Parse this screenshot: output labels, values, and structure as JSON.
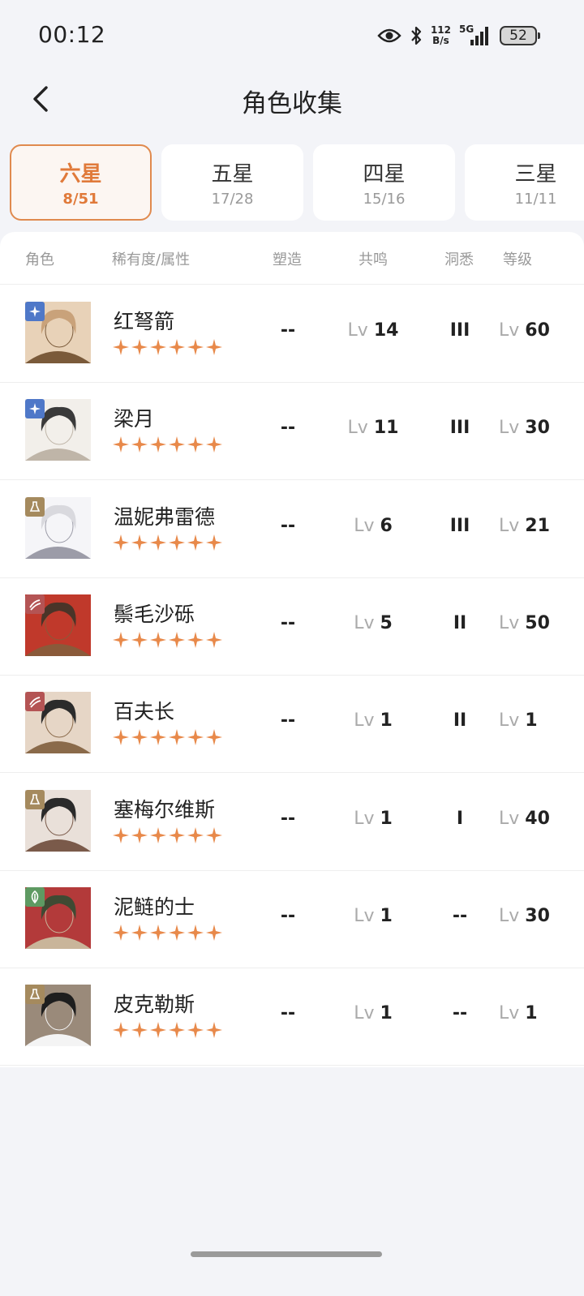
{
  "status_bar": {
    "time": "00:12",
    "net_speed_value": "112",
    "net_speed_unit": "B/s",
    "network": "5G",
    "battery": "52",
    "icons": [
      "eye-icon",
      "bluetooth-icon",
      "signal-icon",
      "battery-icon"
    ]
  },
  "header": {
    "title": "角色收集",
    "back_icon": "chevron-left-icon"
  },
  "tabs": [
    {
      "label": "六星",
      "count": "8/51",
      "active": true
    },
    {
      "label": "五星",
      "count": "17/28",
      "active": false
    },
    {
      "label": "四星",
      "count": "15/16",
      "active": false
    },
    {
      "label": "三星",
      "count": "11/11",
      "active": false
    }
  ],
  "table": {
    "headers": {
      "character": "角色",
      "rarity": "稀有度/属性",
      "shaping": "塑造",
      "resonance": "共鸣",
      "insight": "洞悉",
      "level": "等级"
    },
    "lv_prefix": "Lv",
    "rows": [
      {
        "name": "红弩箭",
        "stars": 6,
        "element": "star-element-icon",
        "element_color": "#4f78c8",
        "shaping": "--",
        "resonance": "14",
        "insight": "III",
        "level": "60"
      },
      {
        "name": "梁月",
        "stars": 6,
        "element": "star-element-icon",
        "element_color": "#4f78c8",
        "shaping": "--",
        "resonance": "11",
        "insight": "III",
        "level": "30"
      },
      {
        "name": "温妮弗雷德",
        "stars": 6,
        "element": "flask-element-icon",
        "element_color": "#a58a5e",
        "shaping": "--",
        "resonance": "6",
        "insight": "III",
        "level": "21"
      },
      {
        "name": "鬃毛沙砾",
        "stars": 6,
        "element": "claw-element-icon",
        "element_color": "#b45454",
        "shaping": "--",
        "resonance": "5",
        "insight": "II",
        "level": "50"
      },
      {
        "name": "百夫长",
        "stars": 6,
        "element": "claw-element-icon",
        "element_color": "#b45454",
        "shaping": "--",
        "resonance": "1",
        "insight": "II",
        "level": "1"
      },
      {
        "name": "塞梅尔维斯",
        "stars": 6,
        "element": "flask-element-icon",
        "element_color": "#a58a5e",
        "shaping": "--",
        "resonance": "1",
        "insight": "I",
        "level": "40"
      },
      {
        "name": "泥鲢的士",
        "stars": 6,
        "element": "leaf-element-icon",
        "element_color": "#5e9a62",
        "shaping": "--",
        "resonance": "1",
        "insight": "--",
        "level": "30"
      },
      {
        "name": "皮克勒斯",
        "stars": 6,
        "element": "flask-element-icon",
        "element_color": "#a58a5e",
        "shaping": "--",
        "resonance": "1",
        "insight": "--",
        "level": "1"
      }
    ]
  },
  "colors": {
    "accent": "#e07a3a",
    "star": "#e8894a",
    "background": "#f3f4f8",
    "card": "#ffffff"
  }
}
